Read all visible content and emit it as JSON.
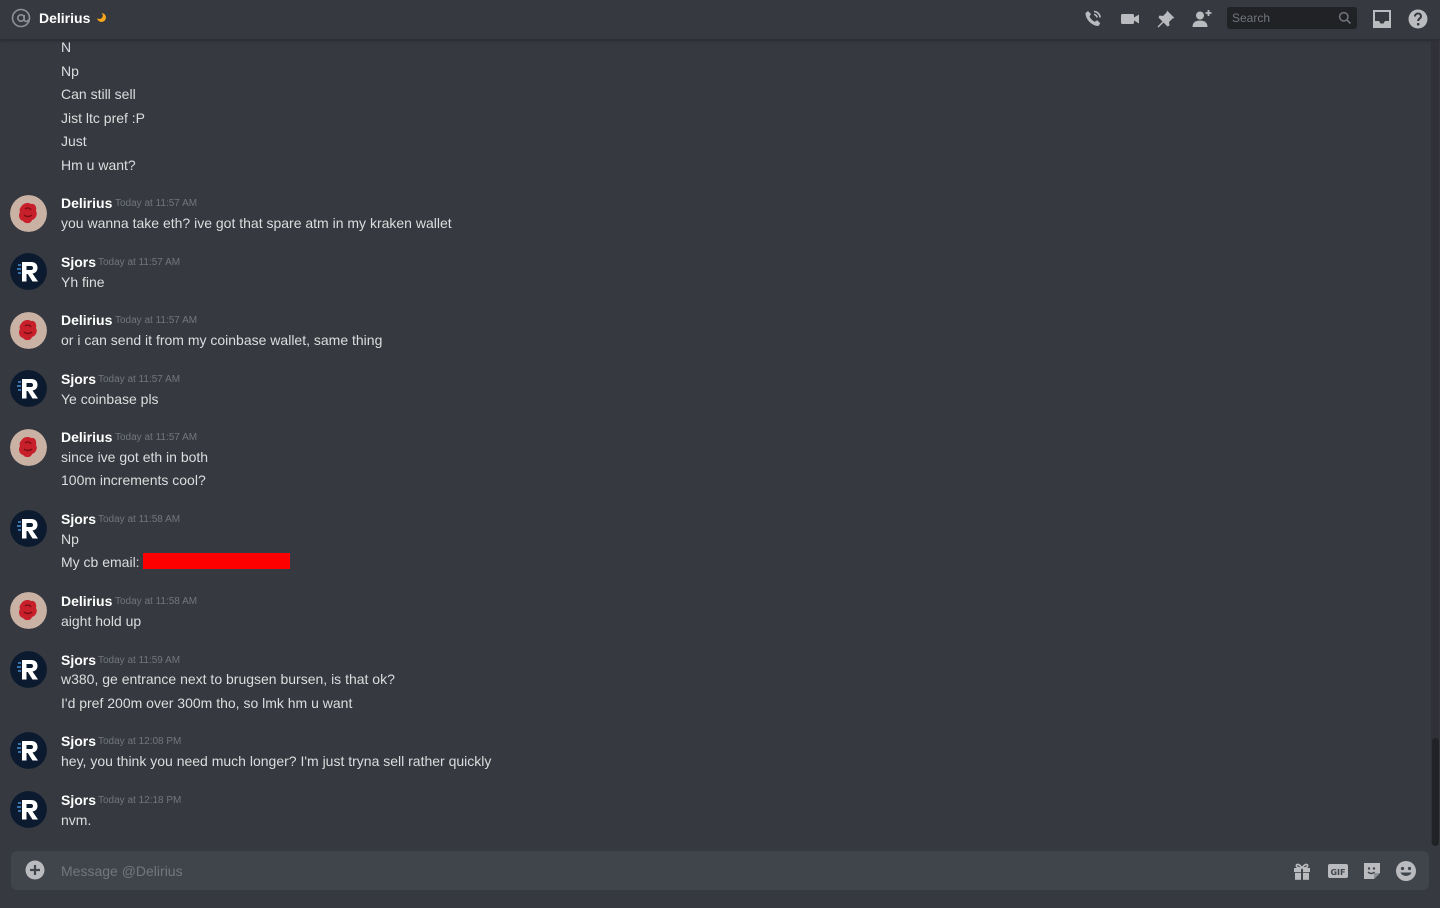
{
  "header": {
    "channel_name": "Delirius",
    "icons": [
      "at-icon",
      "status-moon-icon",
      "call-icon",
      "video-icon",
      "pin-icon",
      "add-friend-icon",
      "inbox-icon",
      "help-icon"
    ],
    "search_placeholder": "Search"
  },
  "colors": {
    "background": "#36393f",
    "composer": "#40444b",
    "text": "#dcddde",
    "author": "#ffffff",
    "timestamp": "#72767d",
    "redaction": "#ff0000",
    "status_idle": "#faa61a"
  },
  "messages": {
    "continued_lines": [
      "N",
      "Np",
      "Can still sell",
      "Jist ltc pref :P",
      "Just",
      "Hm u want?"
    ],
    "groups": [
      {
        "author": "Delirius",
        "timestamp": "Today at 11:57 AM",
        "lines": [
          "you wanna take eth? ive got that spare atm in my kraken wallet"
        ]
      },
      {
        "author": "Sjors",
        "timestamp": "Today at 11:57 AM",
        "lines": [
          "Yh fine"
        ]
      },
      {
        "author": "Delirius",
        "timestamp": "Today at 11:57 AM",
        "lines": [
          "or i can send it from my coinbase wallet, same thing"
        ]
      },
      {
        "author": "Sjors",
        "timestamp": "Today at 11:57 AM",
        "lines": [
          "Ye coinbase pls"
        ]
      },
      {
        "author": "Delirius",
        "timestamp": "Today at 11:57 AM",
        "lines": [
          "since ive got eth in both",
          "100m increments cool?"
        ]
      },
      {
        "author": "Sjors",
        "timestamp": "Today at 11:58 AM",
        "lines": [
          "Np",
          "My cb email:"
        ]
      },
      {
        "author": "Delirius",
        "timestamp": "Today at 11:58 AM",
        "lines": [
          "aight hold up"
        ]
      },
      {
        "author": "Sjors",
        "timestamp": "Today at 11:59 AM",
        "lines": [
          "w380, ge entrance next to brugsen bursen, is that ok?",
          "I'd pref 200m over 300m tho, so lmk hm u want"
        ]
      },
      {
        "author": "Sjors",
        "timestamp": "Today at 12:08 PM",
        "lines": [
          "hey, you think you need much longer? I'm just tryna sell rather quickly"
        ]
      },
      {
        "author": "Sjors",
        "timestamp": "Today at 12:18 PM",
        "lines": [
          "nvm."
        ]
      }
    ]
  },
  "composer": {
    "placeholder": "Message @Delirius",
    "icons": [
      "add-attachment-icon",
      "gift-icon",
      "gif-icon",
      "sticker-icon",
      "emoji-icon"
    ]
  }
}
